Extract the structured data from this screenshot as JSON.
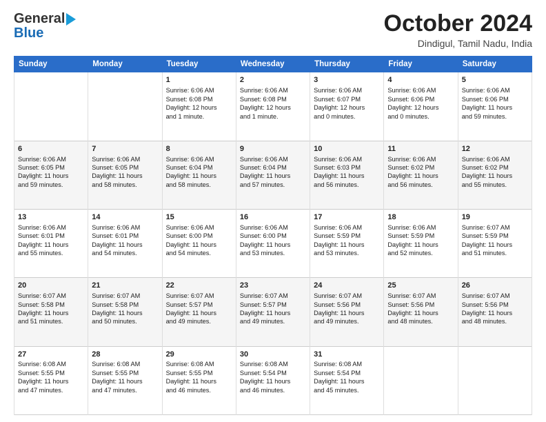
{
  "header": {
    "logo_line1": "General",
    "logo_line2": "Blue",
    "month_title": "October 2024",
    "location": "Dindigul, Tamil Nadu, India"
  },
  "days_of_week": [
    "Sunday",
    "Monday",
    "Tuesday",
    "Wednesday",
    "Thursday",
    "Friday",
    "Saturday"
  ],
  "weeks": [
    [
      {
        "day": "",
        "text": ""
      },
      {
        "day": "",
        "text": ""
      },
      {
        "day": "1",
        "text": "Sunrise: 6:06 AM\nSunset: 6:08 PM\nDaylight: 12 hours\nand 1 minute."
      },
      {
        "day": "2",
        "text": "Sunrise: 6:06 AM\nSunset: 6:08 PM\nDaylight: 12 hours\nand 1 minute."
      },
      {
        "day": "3",
        "text": "Sunrise: 6:06 AM\nSunset: 6:07 PM\nDaylight: 12 hours\nand 0 minutes."
      },
      {
        "day": "4",
        "text": "Sunrise: 6:06 AM\nSunset: 6:06 PM\nDaylight: 12 hours\nand 0 minutes."
      },
      {
        "day": "5",
        "text": "Sunrise: 6:06 AM\nSunset: 6:06 PM\nDaylight: 11 hours\nand 59 minutes."
      }
    ],
    [
      {
        "day": "6",
        "text": "Sunrise: 6:06 AM\nSunset: 6:05 PM\nDaylight: 11 hours\nand 59 minutes."
      },
      {
        "day": "7",
        "text": "Sunrise: 6:06 AM\nSunset: 6:05 PM\nDaylight: 11 hours\nand 58 minutes."
      },
      {
        "day": "8",
        "text": "Sunrise: 6:06 AM\nSunset: 6:04 PM\nDaylight: 11 hours\nand 58 minutes."
      },
      {
        "day": "9",
        "text": "Sunrise: 6:06 AM\nSunset: 6:04 PM\nDaylight: 11 hours\nand 57 minutes."
      },
      {
        "day": "10",
        "text": "Sunrise: 6:06 AM\nSunset: 6:03 PM\nDaylight: 11 hours\nand 56 minutes."
      },
      {
        "day": "11",
        "text": "Sunrise: 6:06 AM\nSunset: 6:02 PM\nDaylight: 11 hours\nand 56 minutes."
      },
      {
        "day": "12",
        "text": "Sunrise: 6:06 AM\nSunset: 6:02 PM\nDaylight: 11 hours\nand 55 minutes."
      }
    ],
    [
      {
        "day": "13",
        "text": "Sunrise: 6:06 AM\nSunset: 6:01 PM\nDaylight: 11 hours\nand 55 minutes."
      },
      {
        "day": "14",
        "text": "Sunrise: 6:06 AM\nSunset: 6:01 PM\nDaylight: 11 hours\nand 54 minutes."
      },
      {
        "day": "15",
        "text": "Sunrise: 6:06 AM\nSunset: 6:00 PM\nDaylight: 11 hours\nand 54 minutes."
      },
      {
        "day": "16",
        "text": "Sunrise: 6:06 AM\nSunset: 6:00 PM\nDaylight: 11 hours\nand 53 minutes."
      },
      {
        "day": "17",
        "text": "Sunrise: 6:06 AM\nSunset: 5:59 PM\nDaylight: 11 hours\nand 53 minutes."
      },
      {
        "day": "18",
        "text": "Sunrise: 6:06 AM\nSunset: 5:59 PM\nDaylight: 11 hours\nand 52 minutes."
      },
      {
        "day": "19",
        "text": "Sunrise: 6:07 AM\nSunset: 5:59 PM\nDaylight: 11 hours\nand 51 minutes."
      }
    ],
    [
      {
        "day": "20",
        "text": "Sunrise: 6:07 AM\nSunset: 5:58 PM\nDaylight: 11 hours\nand 51 minutes."
      },
      {
        "day": "21",
        "text": "Sunrise: 6:07 AM\nSunset: 5:58 PM\nDaylight: 11 hours\nand 50 minutes."
      },
      {
        "day": "22",
        "text": "Sunrise: 6:07 AM\nSunset: 5:57 PM\nDaylight: 11 hours\nand 49 minutes."
      },
      {
        "day": "23",
        "text": "Sunrise: 6:07 AM\nSunset: 5:57 PM\nDaylight: 11 hours\nand 49 minutes."
      },
      {
        "day": "24",
        "text": "Sunrise: 6:07 AM\nSunset: 5:56 PM\nDaylight: 11 hours\nand 49 minutes."
      },
      {
        "day": "25",
        "text": "Sunrise: 6:07 AM\nSunset: 5:56 PM\nDaylight: 11 hours\nand 48 minutes."
      },
      {
        "day": "26",
        "text": "Sunrise: 6:07 AM\nSunset: 5:56 PM\nDaylight: 11 hours\nand 48 minutes."
      }
    ],
    [
      {
        "day": "27",
        "text": "Sunrise: 6:08 AM\nSunset: 5:55 PM\nDaylight: 11 hours\nand 47 minutes."
      },
      {
        "day": "28",
        "text": "Sunrise: 6:08 AM\nSunset: 5:55 PM\nDaylight: 11 hours\nand 47 minutes."
      },
      {
        "day": "29",
        "text": "Sunrise: 6:08 AM\nSunset: 5:55 PM\nDaylight: 11 hours\nand 46 minutes."
      },
      {
        "day": "30",
        "text": "Sunrise: 6:08 AM\nSunset: 5:54 PM\nDaylight: 11 hours\nand 46 minutes."
      },
      {
        "day": "31",
        "text": "Sunrise: 6:08 AM\nSunset: 5:54 PM\nDaylight: 11 hours\nand 45 minutes."
      },
      {
        "day": "",
        "text": ""
      },
      {
        "day": "",
        "text": ""
      }
    ]
  ]
}
